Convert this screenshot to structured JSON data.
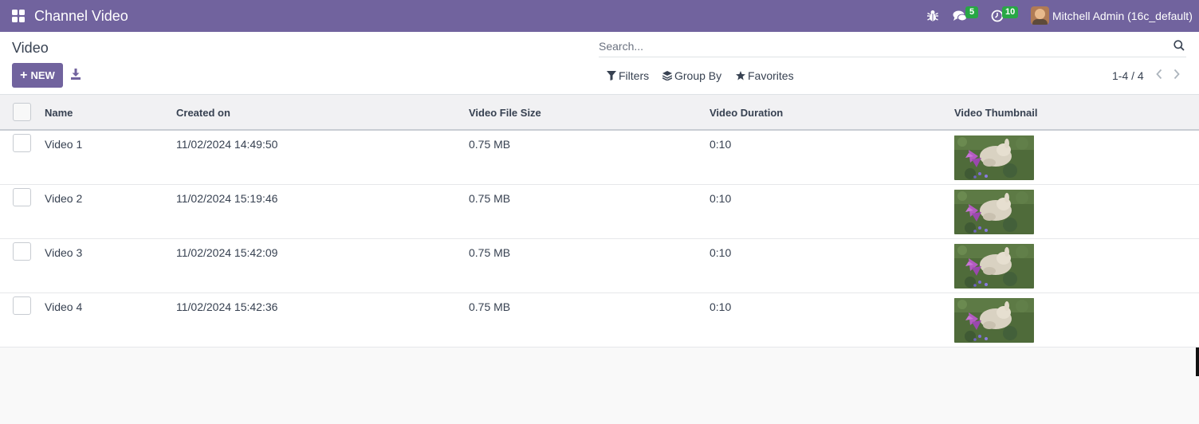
{
  "navbar": {
    "app_title": "Channel Video",
    "chat_count": "5",
    "activity_count": "10",
    "user_name": "Mitchell Admin (16c_default)",
    "icons": [
      "apps-icon",
      "bug-icon",
      "chat-icon",
      "clock-icon",
      "avatar"
    ]
  },
  "control_panel": {
    "breadcrumb": "Video",
    "new_label": "NEW",
    "search_placeholder": "Search...",
    "filters_label": "Filters",
    "group_by_label": "Group By",
    "favorites_label": "Favorites",
    "pager": "1-4 / 4"
  },
  "table": {
    "columns": [
      "Name",
      "Created on",
      "Video File Size",
      "Video Duration",
      "Video Thumbnail"
    ],
    "rows": [
      {
        "name": "Video 1",
        "created_on": "11/02/2024 14:49:50",
        "size": "0.75 MB",
        "duration": "0:10"
      },
      {
        "name": "Video 2",
        "created_on": "11/02/2024 15:19:46",
        "size": "0.75 MB",
        "duration": "0:10"
      },
      {
        "name": "Video 3",
        "created_on": "11/02/2024 15:42:09",
        "size": "0.75 MB",
        "duration": "0:10"
      },
      {
        "name": "Video 4",
        "created_on": "11/02/2024 15:42:36",
        "size": "0.75 MB",
        "duration": "0:10"
      }
    ]
  },
  "colors": {
    "brand": "#71639e",
    "badge": "#28a745"
  }
}
